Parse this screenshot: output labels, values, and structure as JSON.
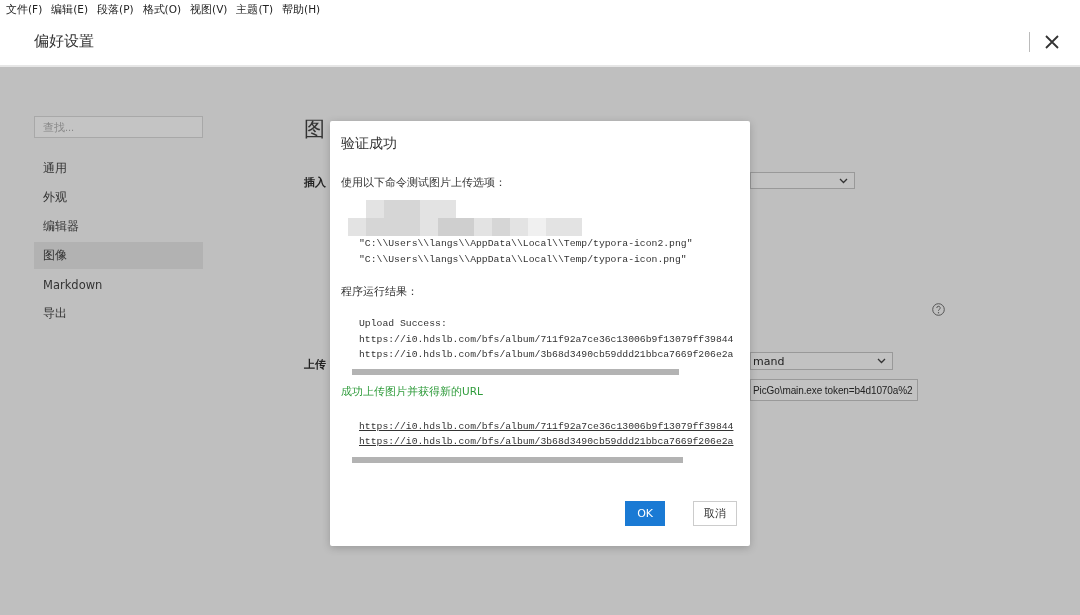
{
  "menu_bar": [
    "文件(F)",
    "编辑(E)",
    "段落(P)",
    "格式(O)",
    "视图(V)",
    "主题(T)",
    "帮助(H)"
  ],
  "window": {
    "title": "偏好设置"
  },
  "sidebar": {
    "search": {
      "placeholder": "查找..."
    },
    "items": [
      {
        "label": "通用",
        "selected": false
      },
      {
        "label": "外观",
        "selected": false
      },
      {
        "label": "编辑器",
        "selected": false
      },
      {
        "label": "图像",
        "selected": true
      },
      {
        "label": "Markdown",
        "selected": false
      },
      {
        "label": "导出",
        "selected": false
      }
    ]
  },
  "settings": {
    "heading": "图",
    "insert_label": "插入",
    "upload_label": "上传",
    "uploader_select": {
      "value": "mand"
    },
    "command_field": {
      "value": "PicGo\\main.exe token=b4d1070a%2"
    }
  },
  "dialog": {
    "title": "验证成功",
    "prompt": "使用以下命令测试图片上传选项：",
    "command_lines": [
      "\"C:\\\\Users\\\\langs\\\\AppData\\\\Local\\\\Temp/typora-icon2.png\"",
      "\"C:\\\\Users\\\\langs\\\\AppData\\\\Local\\\\Temp/typora-icon.png\""
    ],
    "result_label": "程序运行结果：",
    "output_lines": [
      "Upload Success:",
      "https://i0.hdslb.com/bfs/album/711f92a7ce36c13006b9f13079ff39844",
      "https://i0.hdslb.com/bfs/album/3b68d3490cb59ddd21bbca7669f206e2a"
    ],
    "success_message": "成功上传图片并获得新的URL",
    "url_links": [
      "https://i0.hdslb.com/bfs/album/711f92a7ce36c13006b9f13079ff39844",
      "https://i0.hdslb.com/bfs/album/3b68d3490cb59ddd21bbca7669f206e2a"
    ],
    "buttons": [
      {
        "label": "OK",
        "kind": "primary"
      },
      {
        "label": "取消",
        "kind": "secondary"
      }
    ]
  }
}
